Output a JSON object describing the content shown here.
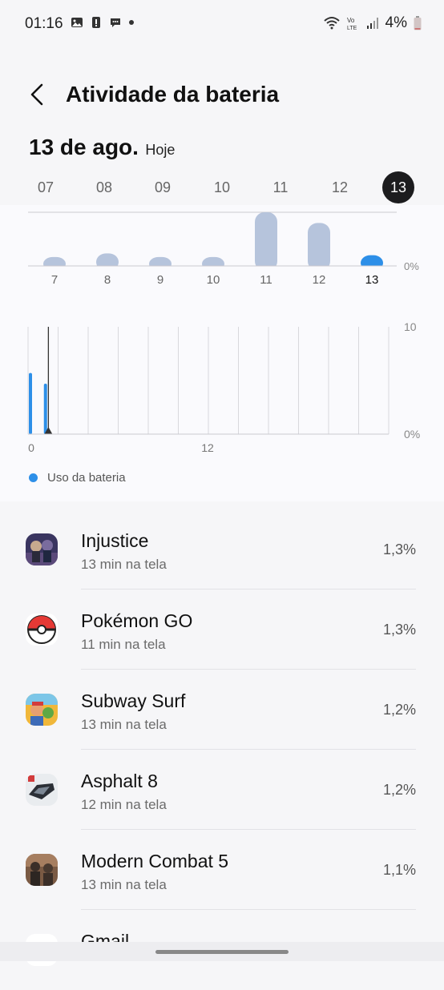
{
  "status": {
    "time": "01:16",
    "battery_pct": "4%"
  },
  "header": {
    "title": "Atividade da bateria"
  },
  "date": {
    "main": "13 de ago.",
    "sub": "Hoje"
  },
  "days": [
    "07",
    "08",
    "09",
    "10",
    "11",
    "12",
    "13"
  ],
  "selected_day": "13",
  "chart_data": [
    {
      "type": "bar",
      "categories": [
        "7",
        "8",
        "9",
        "10",
        "11",
        "12",
        "13"
      ],
      "values": [
        5,
        7,
        5,
        5,
        30,
        24,
        6
      ],
      "ylabel": "",
      "ytick_labels": [
        "0%"
      ],
      "ylim": [
        0,
        30
      ],
      "colors": {
        "bar": "#b6c4dc",
        "selected": "#2d8fe8"
      }
    },
    {
      "type": "bar",
      "x_tick_labels": [
        "0",
        "12"
      ],
      "ytick_labels": [
        "10",
        "0%"
      ],
      "ylim": [
        0,
        10
      ],
      "hours": [
        0,
        1
      ],
      "values": [
        5.7,
        4.7
      ],
      "current_hour": 1.3,
      "legend": "Uso da bateria",
      "colors": {
        "bar": "#2d8fe8"
      }
    }
  ],
  "apps": [
    {
      "name": "Injustice",
      "screen_time": "13 min na tela",
      "pct": "1,3%",
      "icon": "injustice-icon"
    },
    {
      "name": "Pokémon GO",
      "screen_time": "11 min na tela",
      "pct": "1,3%",
      "icon": "pokeball-icon"
    },
    {
      "name": "Subway Surf",
      "screen_time": "13 min na tela",
      "pct": "1,2%",
      "icon": "subway-surf-icon"
    },
    {
      "name": "Asphalt 8",
      "screen_time": "12 min na tela",
      "pct": "1,2%",
      "icon": "asphalt-icon"
    },
    {
      "name": "Modern Combat 5",
      "screen_time": "13 min na tela",
      "pct": "1,1%",
      "icon": "modern-combat-icon"
    },
    {
      "name": "Gmail",
      "screen_time": "",
      "pct": "",
      "icon": "gmail-icon"
    }
  ]
}
